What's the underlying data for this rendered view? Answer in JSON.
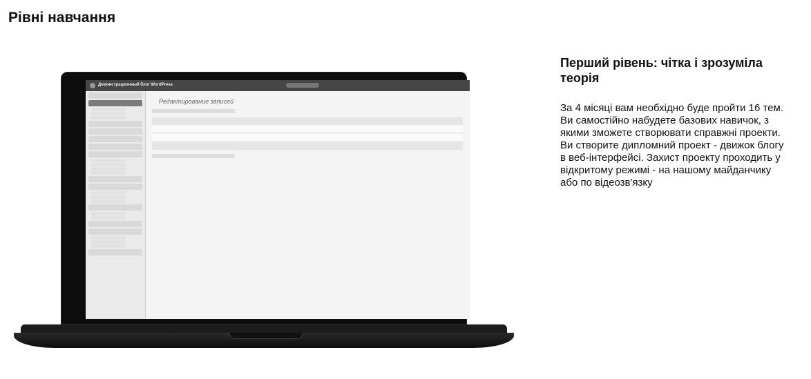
{
  "page": {
    "title": "Рівні навчання"
  },
  "level": {
    "title": "Перший рівень: чітка і зрозуміла теорія",
    "description": "За 4 місяці вам необхідно буде пройти 16 тем. Ви самостійно набудете базових навичок, з якими зможете створювати справжні проекти. Ви створите дипломний проект - движок блогу в веб-інтерфейсі. Захист проекту проходить у відкритому режимі - на нашому майданчику або по відеозв'язку"
  },
  "laptop_screen": {
    "window_title": "Демонстрационный блог WordPress",
    "heading": "Редактирование записей"
  }
}
